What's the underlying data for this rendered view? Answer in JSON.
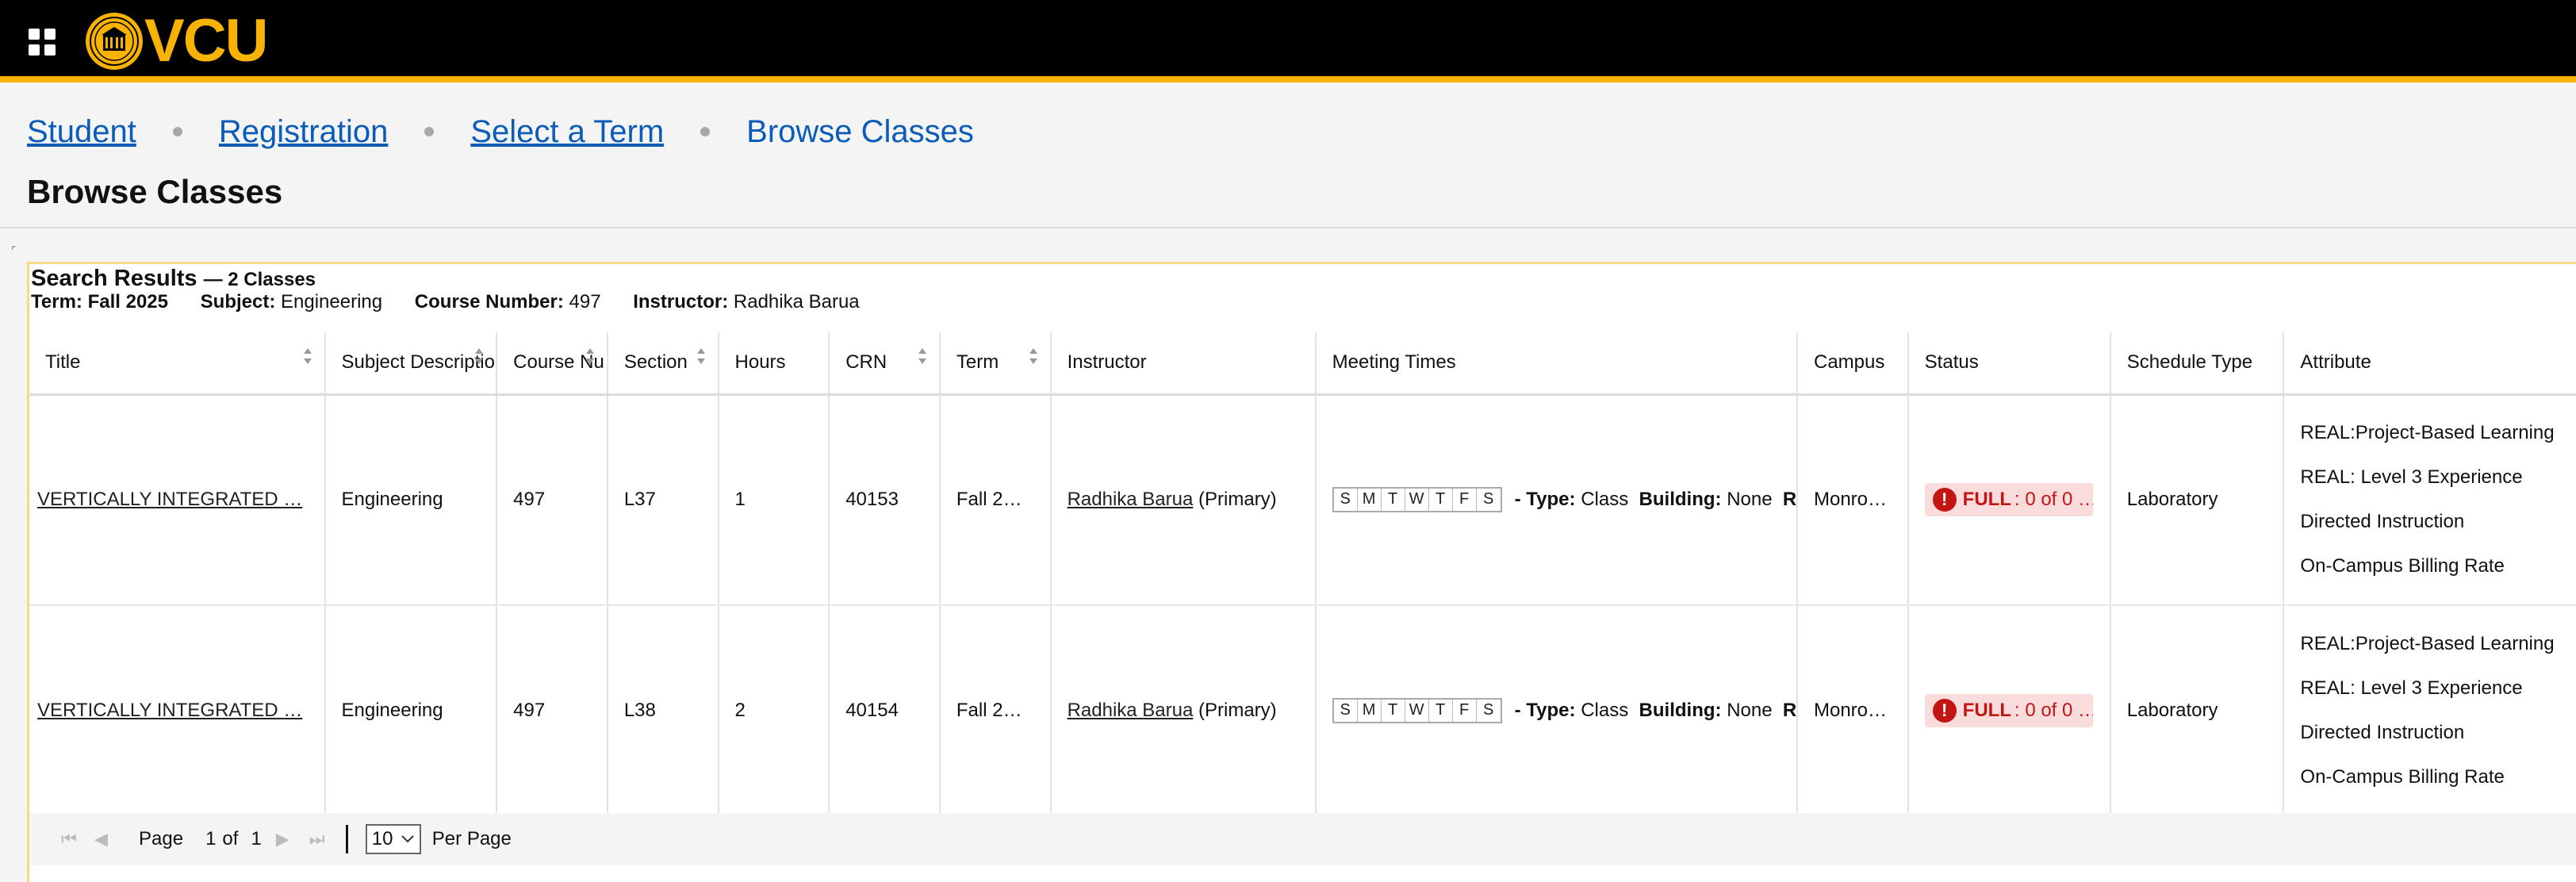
{
  "header": {
    "logo_text": "VCU",
    "accent_color": "#f8b300",
    "grid_icon": "app-grid-icon"
  },
  "breadcrumb": {
    "items": [
      "Student",
      "Registration",
      "Select a Term"
    ],
    "current": "Browse Classes"
  },
  "page_title": "Browse Classes",
  "results": {
    "title": "Search Results",
    "count_text": "— 2 Classes",
    "filters": [
      {
        "label": "Term:",
        "value": "Fall 2025"
      },
      {
        "label": "Subject:",
        "value": "Engineering"
      },
      {
        "label": "Course Number:",
        "value": "497"
      },
      {
        "label": "Instructor:",
        "value": "Radhika Barua"
      }
    ]
  },
  "table": {
    "columns": [
      "Title",
      "Subject Descriptio",
      "Course Nu",
      "Section",
      "Hours",
      "CRN",
      "Term",
      "Instructor",
      "Meeting Times",
      "Campus",
      "Status",
      "Schedule Type",
      "Attribute"
    ],
    "rows": [
      {
        "title": "VERTICALLY INTEGRATED …",
        "subject": "Engineering",
        "course_number": "497",
        "section": "L37",
        "hours": "1",
        "crn": "40153",
        "term": "Fall 2…",
        "instructor": "Radhika Barua",
        "instructor_role": "(Primary)",
        "days": [
          "S",
          "M",
          "T",
          "W",
          "T",
          "F",
          "S"
        ],
        "type_label": "- Type:",
        "type_value": "Class",
        "building_label": "Building:",
        "building_value": "None",
        "room_label": "R",
        "campus": "Monro…",
        "status_label": "FULL",
        "status_text": ": 0 of 0 …",
        "schedule_type": "Laboratory",
        "attributes": [
          "REAL:Project-Based Learning",
          "REAL: Level 3 Experience",
          "Directed Instruction",
          "On-Campus Billing Rate"
        ]
      },
      {
        "title": "VERTICALLY INTEGRATED …",
        "subject": "Engineering",
        "course_number": "497",
        "section": "L38",
        "hours": "2",
        "crn": "40154",
        "term": "Fall 2…",
        "instructor": "Radhika Barua",
        "instructor_role": "(Primary)",
        "days": [
          "S",
          "M",
          "T",
          "W",
          "T",
          "F",
          "S"
        ],
        "type_label": "- Type:",
        "type_value": "Class",
        "building_label": "Building:",
        "building_value": "None",
        "room_label": "R",
        "campus": "Monro…",
        "status_label": "FULL",
        "status_text": ": 0 of 0 …",
        "schedule_type": "Laboratory",
        "attributes": [
          "REAL:Project-Based Learning",
          "REAL: Level 3 Experience",
          "Directed Instruction",
          "On-Campus Billing Rate"
        ]
      }
    ]
  },
  "pager": {
    "page_label": "Page",
    "page_number": "1",
    "of_label": "of",
    "total_pages": "1",
    "per_page_value": "10",
    "per_page_label": "Per Page"
  },
  "colors": {
    "link": "#0a5cb8",
    "status_full_bg": "#fadcdc",
    "status_full_text": "#c41515"
  }
}
